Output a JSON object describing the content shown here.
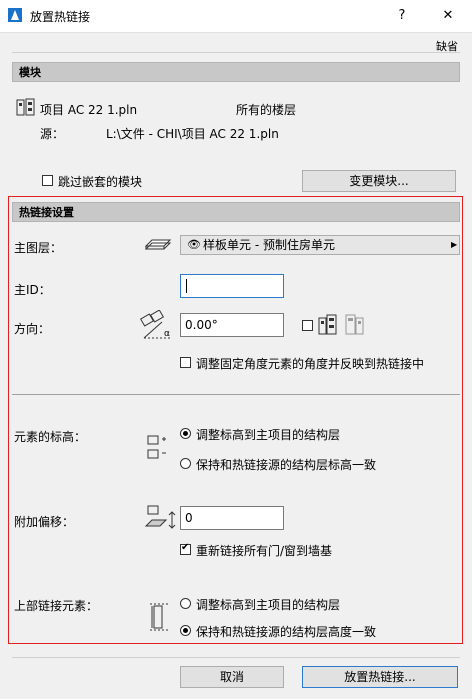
{
  "window": {
    "title": "放置热链接",
    "help": "?",
    "close": "✕"
  },
  "default_label": "缺省",
  "module_section": {
    "header": "模块",
    "project_name": "项目 AC 22 1.pln",
    "story": "所有的楼层",
    "source_label": "源：",
    "source_path": "L:\\文件 - CHI\\项目 AC 22 1.pln",
    "skip_nested_label": "跳过嵌套的模块",
    "change_module_button": "变更模块..."
  },
  "hotlink_settings": {
    "header": "热链接设置",
    "main_layer_label": "主图层：",
    "main_layer_value": "样板单元 - 预制住房单元",
    "main_id_label": "主ID：",
    "main_id_value": "",
    "direction_label": "方向：",
    "direction_value": "0.00°",
    "adjust_angle_label": "调整固定角度元素的角度并反映到热链接中",
    "elevation_label": "元素的标高：",
    "elevation_option1": "调整标高到主项目的结构层",
    "elevation_option2": "保持和热链接源的结构层标高一致",
    "offset_label": "附加偏移：",
    "offset_value": "0",
    "relink_doors_label": "重新链接所有门/窗到墙基",
    "top_link_label": "上部链接元素：",
    "top_link_option1": "调整标高到主项目的结构层",
    "top_link_option2": "保持和热链接源的结构层高度一致"
  },
  "footer": {
    "cancel": "取消",
    "place": "放置热链接..."
  },
  "colors": {
    "highlight_frame": "#e02020",
    "header_bg": "#c8c8c8"
  }
}
